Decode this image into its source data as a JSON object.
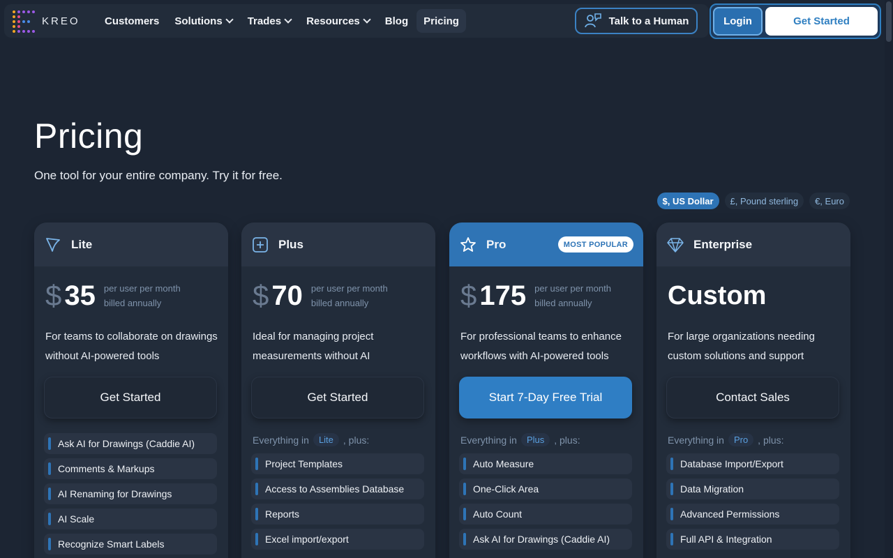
{
  "nav": {
    "logo_text": "KREO",
    "links": [
      {
        "label": "Customers"
      },
      {
        "label": "Solutions"
      },
      {
        "label": "Trades"
      },
      {
        "label": "Resources"
      },
      {
        "label": "Blog"
      },
      {
        "label": "Pricing"
      }
    ],
    "talk_label": "Talk to a Human",
    "login_label": "Login",
    "get_started_label": "Get Started"
  },
  "hero": {
    "title": "Pricing",
    "subtitle": "One tool for your entire company. Try it for free."
  },
  "currencies": [
    {
      "label": "$, US Dollar"
    },
    {
      "label": "£, Pound sterling"
    },
    {
      "label": "€, Euro"
    }
  ],
  "plans": [
    {
      "name": "Lite",
      "currency_symbol": "$",
      "price": "35",
      "per_line1": "per user per month",
      "per_line2": "billed annually",
      "description": "For teams to collaborate on drawings without AI-powered tools",
      "cta": "Get Started",
      "features": [
        "Ask AI for Drawings (Caddie AI)",
        "Comments & Markups",
        "AI Renaming for Drawings",
        "AI Scale",
        "Recognize Smart Labels"
      ]
    },
    {
      "name": "Plus",
      "currency_symbol": "$",
      "price": "70",
      "per_line1": "per user per month",
      "per_line2": "billed annually",
      "description": "Ideal for managing project measurements without AI",
      "cta": "Get Started",
      "everything_prefix": "Everything in",
      "everything_plan": "Lite",
      "everything_suffix": ", plus:",
      "features": [
        "Project Templates",
        "Access to Assemblies Database",
        "Reports",
        "Excel import/export"
      ]
    },
    {
      "name": "Pro",
      "badge": "MOST POPULAR",
      "currency_symbol": "$",
      "price": "175",
      "per_line1": "per user per month",
      "per_line2": "billed annually",
      "description": "For professional teams to enhance workflows with AI-powered tools",
      "cta": "Start 7-Day Free Trial",
      "everything_prefix": "Everything in",
      "everything_plan": "Plus",
      "everything_suffix": ", plus:",
      "features": [
        "Auto Measure",
        "One-Click Area",
        "Auto Count",
        "Ask AI for Drawings (Caddie AI)"
      ]
    },
    {
      "name": "Enterprise",
      "price_custom": "Custom",
      "description": "For large organizations needing custom solutions and support",
      "cta": "Contact Sales",
      "everything_prefix": "Everything in",
      "everything_plan": "Pro",
      "everything_suffix": ", plus:",
      "features": [
        "Database Import/Export",
        "Data Migration",
        "Advanced Permissions",
        "Full API & Integration"
      ]
    }
  ],
  "colors": {
    "background": "#1c2533",
    "card": "#222c3a",
    "accent": "#2f74b5"
  }
}
